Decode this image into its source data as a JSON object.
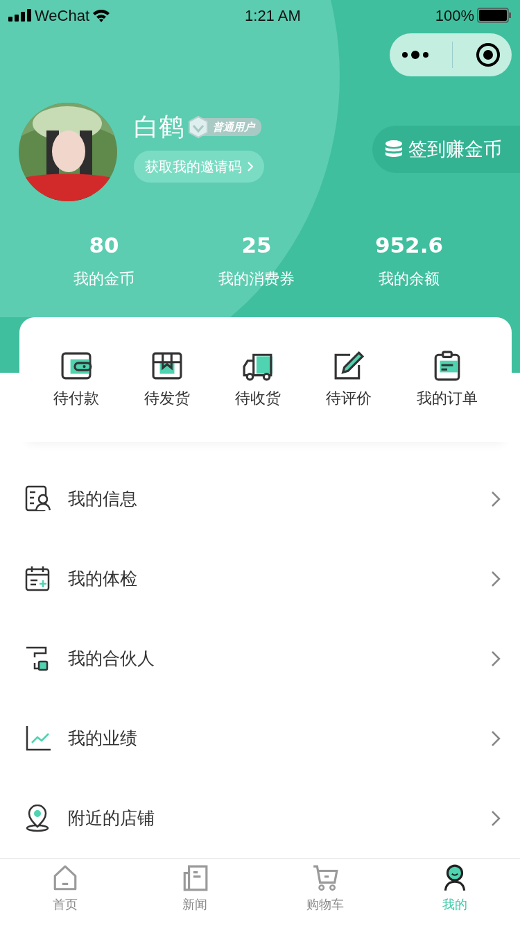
{
  "status_bar": {
    "carrier": "WeChat",
    "time": "1:21 AM",
    "battery": "100%"
  },
  "profile": {
    "name": "白鹤",
    "badge": "普通用户",
    "invite_button": "获取我的邀请码",
    "checkin_button": "签到赚金币"
  },
  "stats": [
    {
      "value": "80",
      "label": "我的金币"
    },
    {
      "value": "25",
      "label": "我的消费券"
    },
    {
      "value": "952.6",
      "label": "我的余额"
    }
  ],
  "orders": [
    {
      "label": "待付款",
      "kind": "wallet"
    },
    {
      "label": "待发货",
      "kind": "box"
    },
    {
      "label": "待收货",
      "kind": "truck"
    },
    {
      "label": "待评价",
      "kind": "edit"
    },
    {
      "label": "我的订单",
      "kind": "clipboard"
    }
  ],
  "menu": [
    {
      "label": "我的信息",
      "kind": "profile"
    },
    {
      "label": "我的体检",
      "kind": "calendar"
    },
    {
      "label": "我的合伙人",
      "kind": "partner"
    },
    {
      "label": "我的业绩",
      "kind": "chart"
    },
    {
      "label": "附近的店铺",
      "kind": "location"
    }
  ],
  "tabs": [
    {
      "label": "首页",
      "kind": "home",
      "selected": false
    },
    {
      "label": "新闻",
      "kind": "news",
      "selected": false
    },
    {
      "label": "购物车",
      "kind": "cart",
      "selected": false
    },
    {
      "label": "我的",
      "kind": "me",
      "selected": true
    }
  ]
}
